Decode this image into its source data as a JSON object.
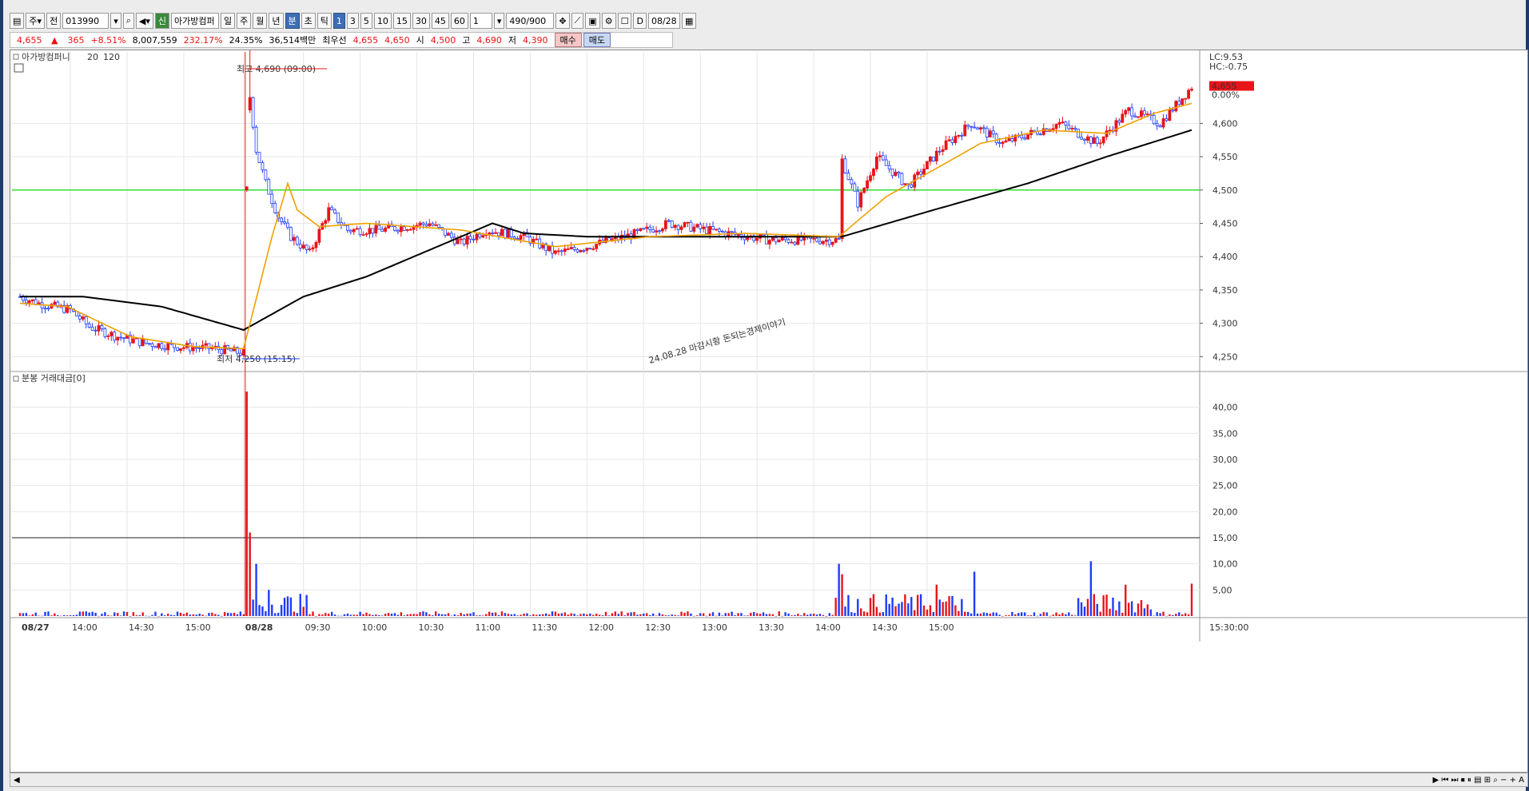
{
  "toolbar": {
    "market": "주",
    "type": "전",
    "code": "013990",
    "name_badge": "신",
    "name": "아가방컴퍼",
    "periods": [
      "일",
      "주",
      "월",
      "년",
      "분",
      "초",
      "틱"
    ],
    "active_period": "분",
    "intervals": [
      "1",
      "3",
      "5",
      "10",
      "15",
      "30",
      "45",
      "60"
    ],
    "active_interval": "1",
    "count_select": "1",
    "count": "490",
    "count_total": "/900",
    "date_label": "D",
    "date": "08/28"
  },
  "quote": {
    "price": "4,655",
    "change_sign": "▲",
    "change": "365",
    "change_pct": "+8.51%",
    "volume": "8,007,559",
    "vol_ratio": "232.17%",
    "turnover_pct": "24.35%",
    "amount": "36,514백만",
    "best_label": "최우선",
    "best_ask": "4,655",
    "best_bid": "4,650",
    "open_label": "시",
    "open": "4,500",
    "high_label": "고",
    "high": "4,690",
    "low_label": "저",
    "low": "4,390",
    "buy_label": "매수",
    "sell_label": "매도"
  },
  "price_panel": {
    "legend_name": "아가방컴퍼니",
    "ma_short": "20",
    "ma_long": "120",
    "lc": "LC:9.53",
    "hc": "HC:-0.75",
    "current_price": "4,655",
    "current_pct": "0.00%",
    "high_note": "최고 4,690 (09:00)",
    "low_note": "최저 4,250 (15:15)",
    "watermark": "24.08.28 마감시황 돈되는경제이야기"
  },
  "volume_panel": {
    "legend": "분봉 거래대금[0]"
  },
  "time_axis": {
    "labels": [
      "08/27",
      "14:00",
      "14:30",
      "15:00",
      "08/28",
      "09:30",
      "10:00",
      "10:30",
      "11:00",
      "11:30",
      "12:00",
      "12:30",
      "13:00",
      "13:30",
      "14:00",
      "14:30",
      "15:00"
    ],
    "end_label": "15:30:00"
  },
  "colors": {
    "up": "#e8141a",
    "down": "#1e3cff",
    "ma20": "#f0a000",
    "ma120": "#000000",
    "hline": "#22dd22",
    "grid": "#e6e6e6"
  },
  "chart_data": {
    "type": "candlestick",
    "price_axis": {
      "ticks": [
        4250,
        4300,
        4350,
        4400,
        4450,
        4500,
        4550,
        4600
      ],
      "ylim": [
        4230,
        4700
      ]
    },
    "volume_axis": {
      "ticks": [
        5,
        10,
        15,
        20,
        25,
        30,
        35,
        40
      ],
      "tick_labels": [
        "5,00",
        "10,00",
        "15,00",
        "20,00",
        "25,00",
        "30,00",
        "35,00",
        "40,00"
      ],
      "ylim": [
        0,
        45
      ]
    },
    "horizontal_line_price": 4500,
    "horizontal_line_volume": 15,
    "series_keypoints": {
      "close": [
        [
          0,
          4340
        ],
        [
          6,
          4330
        ],
        [
          16,
          4320
        ],
        [
          22,
          4295
        ],
        [
          31,
          4280
        ],
        [
          40,
          4270
        ],
        [
          50,
          4265
        ],
        [
          62,
          4262
        ],
        [
          71,
          4255
        ],
        [
          72,
          4500
        ],
        [
          73,
          4640
        ],
        [
          75,
          4560
        ],
        [
          78,
          4510
        ],
        [
          82,
          4460
        ],
        [
          86,
          4430
        ],
        [
          92,
          4405
        ],
        [
          98,
          4470
        ],
        [
          104,
          4440
        ],
        [
          114,
          4440
        ],
        [
          130,
          4450
        ],
        [
          140,
          4420
        ],
        [
          148,
          4440
        ],
        [
          160,
          4430
        ],
        [
          170,
          4405
        ],
        [
          180,
          4415
        ],
        [
          196,
          4435
        ],
        [
          206,
          4450
        ],
        [
          218,
          4440
        ],
        [
          238,
          4425
        ],
        [
          260,
          4425
        ],
        [
          261,
          4545
        ],
        [
          266,
          4480
        ],
        [
          272,
          4550
        ],
        [
          282,
          4505
        ],
        [
          292,
          4560
        ],
        [
          302,
          4600
        ],
        [
          312,
          4570
        ],
        [
          330,
          4600
        ],
        [
          342,
          4570
        ],
        [
          352,
          4620
        ],
        [
          362,
          4600
        ],
        [
          372,
          4655
        ]
      ],
      "ma20": [
        [
          0,
          4330
        ],
        [
          15,
          4325
        ],
        [
          35,
          4280
        ],
        [
          55,
          4265
        ],
        [
          71,
          4262
        ],
        [
          80,
          4430
        ],
        [
          85,
          4510
        ],
        [
          88,
          4470
        ],
        [
          95,
          4445
        ],
        [
          110,
          4450
        ],
        [
          140,
          4440
        ],
        [
          170,
          4415
        ],
        [
          200,
          4430
        ],
        [
          230,
          4435
        ],
        [
          260,
          4430
        ],
        [
          275,
          4490
        ],
        [
          290,
          4530
        ],
        [
          305,
          4570
        ],
        [
          325,
          4590
        ],
        [
          345,
          4585
        ],
        [
          360,
          4615
        ],
        [
          372,
          4630
        ]
      ],
      "ma120": [
        [
          0,
          4340
        ],
        [
          20,
          4340
        ],
        [
          45,
          4325
        ],
        [
          71,
          4290
        ],
        [
          90,
          4340
        ],
        [
          110,
          4370
        ],
        [
          130,
          4410
        ],
        [
          150,
          4450
        ],
        [
          160,
          4435
        ],
        [
          180,
          4430
        ],
        [
          200,
          4430
        ],
        [
          261,
          4430
        ],
        [
          290,
          4470
        ],
        [
          320,
          4510
        ],
        [
          345,
          4550
        ],
        [
          372,
          4590
        ]
      ]
    },
    "price_extremes": {
      "high": 4690,
      "high_time": "09:00",
      "low": 4250,
      "low_time": "15:15"
    },
    "volume_spikes": [
      [
        72,
        43
      ],
      [
        73,
        16
      ],
      [
        75,
        10
      ],
      [
        79,
        5
      ],
      [
        260,
        10
      ],
      [
        261,
        8
      ],
      [
        291,
        6
      ],
      [
        303,
        8.5
      ],
      [
        340,
        10.5
      ],
      [
        351,
        6
      ],
      [
        372,
        6.2
      ]
    ]
  }
}
